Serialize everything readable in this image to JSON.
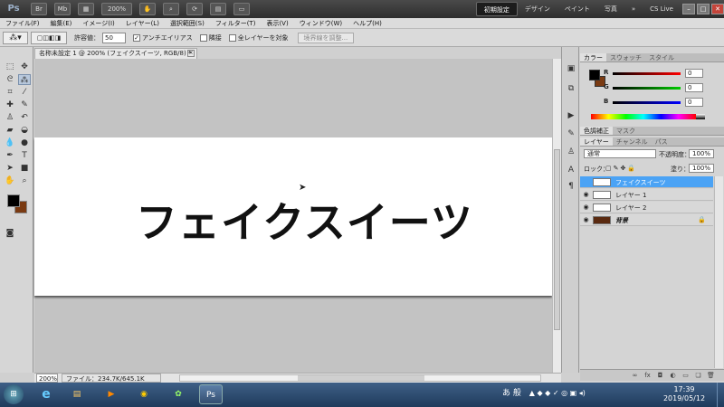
{
  "app": {
    "logo": "Ps",
    "zoom": "200%"
  },
  "workspaces": [
    "初期設定",
    "デザイン",
    "ペイント",
    "写真",
    "»"
  ],
  "cslive": "CS Live",
  "window_controls": [
    "–",
    "□",
    "✕"
  ],
  "menu": [
    "ファイル(F)",
    "編集(E)",
    "イメージ(I)",
    "レイヤー(L)",
    "選択範囲(S)",
    "フィルター(T)",
    "表示(V)",
    "ウィンドウ(W)",
    "ヘルプ(H)"
  ],
  "options": {
    "tolerance_label": "許容値：",
    "tolerance_value": "50",
    "antialias_label": "アンチエイリアス",
    "contiguous_label": "隣接",
    "all_layers_label": "全レイヤーを対象",
    "refine_label": "境界線を調整..."
  },
  "document": {
    "tab_title": "名称未設定 1 @ 200% (フェイクスイーツ, RGB/8) *",
    "close": "×",
    "canvas_text": "フェイクスイーツ"
  },
  "status": {
    "zoom": "200%",
    "file_info": "ファイル：234.7K/645.1K"
  },
  "color_panel": {
    "tabs": [
      "カラー",
      "スウォッチ",
      "スタイル"
    ],
    "channels": [
      {
        "label": "R",
        "value": "0"
      },
      {
        "label": "G",
        "value": "0"
      },
      {
        "label": "B",
        "value": "0"
      }
    ],
    "fg_color": "#000000",
    "bg_color": "#7a3a12"
  },
  "adjust_tabs": [
    "色調補正",
    "マスク"
  ],
  "layers_panel": {
    "tabs": [
      "レイヤー",
      "チャンネル",
      "パス"
    ],
    "blend_mode": "通常",
    "opacity_label": "不透明度：",
    "opacity_value": "100%",
    "lock_label": "ロック：",
    "fill_label": "塗り：",
    "fill_value": "100%",
    "layers": [
      {
        "name": "フェイクスイーツ",
        "thumb": "T"
      },
      {
        "name": "レイヤー 1",
        "thumb": ""
      },
      {
        "name": "レイヤー 2",
        "thumb": ""
      },
      {
        "name": "背景",
        "thumb": ""
      }
    ]
  },
  "taskbar": {
    "tray": "あ 般",
    "time": "17:39",
    "date": "2019/05/12"
  }
}
